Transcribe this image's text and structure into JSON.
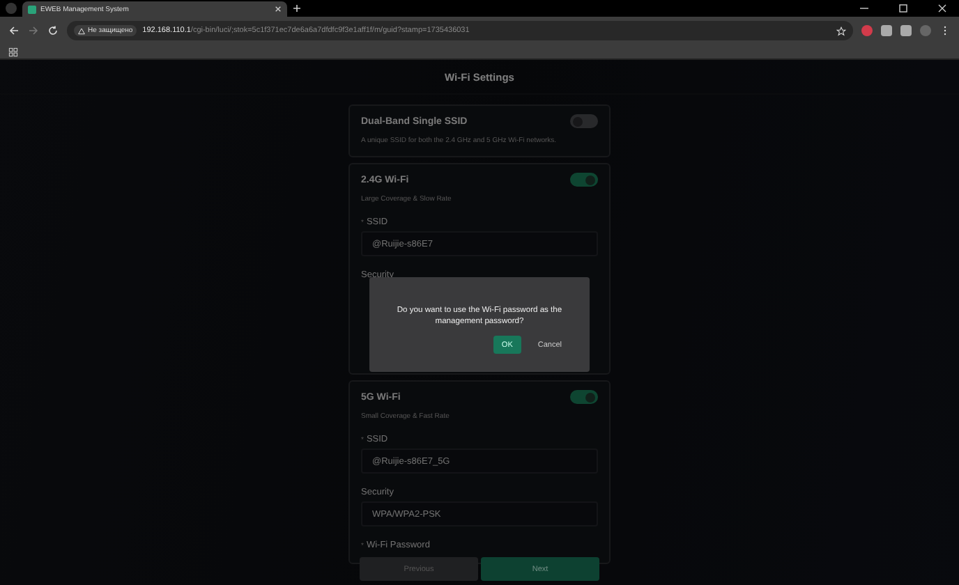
{
  "browser": {
    "tab_title": "EWEB Management System",
    "address_warning": "Не защищено",
    "url_host": "192.168.110.1",
    "url_path": "/cgi-bin/luci/;stok=5c1f371ec7de6a6a7dfdfc9f3e1aff1f/m/guid?stamp=1735436031"
  },
  "page": {
    "title": "Wi-Fi Settings",
    "sections": [
      {
        "title": "Dual-Band Single SSID",
        "description": "A unique SSID for both the 2.4 GHz and 5 GHz Wi-Fi networks.",
        "on": false
      },
      {
        "title": "2.4G Wi-Fi",
        "description": "Large Coverage & Slow Rate",
        "on": true,
        "fields": [
          {
            "marker": "*",
            "label": "SSID",
            "value": "@Ruijie-s86E7"
          },
          {
            "label": "Security"
          }
        ]
      },
      {
        "title": "5G Wi-Fi",
        "description": "Small Coverage & Fast Rate",
        "on": true,
        "fields": [
          {
            "marker": "*",
            "label": "SSID",
            "value": "@Ruijie-s86E7_5G"
          },
          {
            "label": "Security",
            "value": "WPA/WPA2-PSK"
          },
          {
            "marker": "*",
            "label": "Wi-Fi Password"
          }
        ]
      }
    ],
    "buttons": [
      {
        "label": "Previous",
        "kind": "secondary"
      },
      {
        "label": "Next",
        "kind": "primary"
      }
    ]
  },
  "dialog": {
    "message": "Do you want to use the Wi-Fi password as the management password?",
    "buttons": [
      {
        "label": "OK",
        "kind": "primary"
      },
      {
        "label": "Cancel",
        "kind": "text"
      }
    ]
  }
}
